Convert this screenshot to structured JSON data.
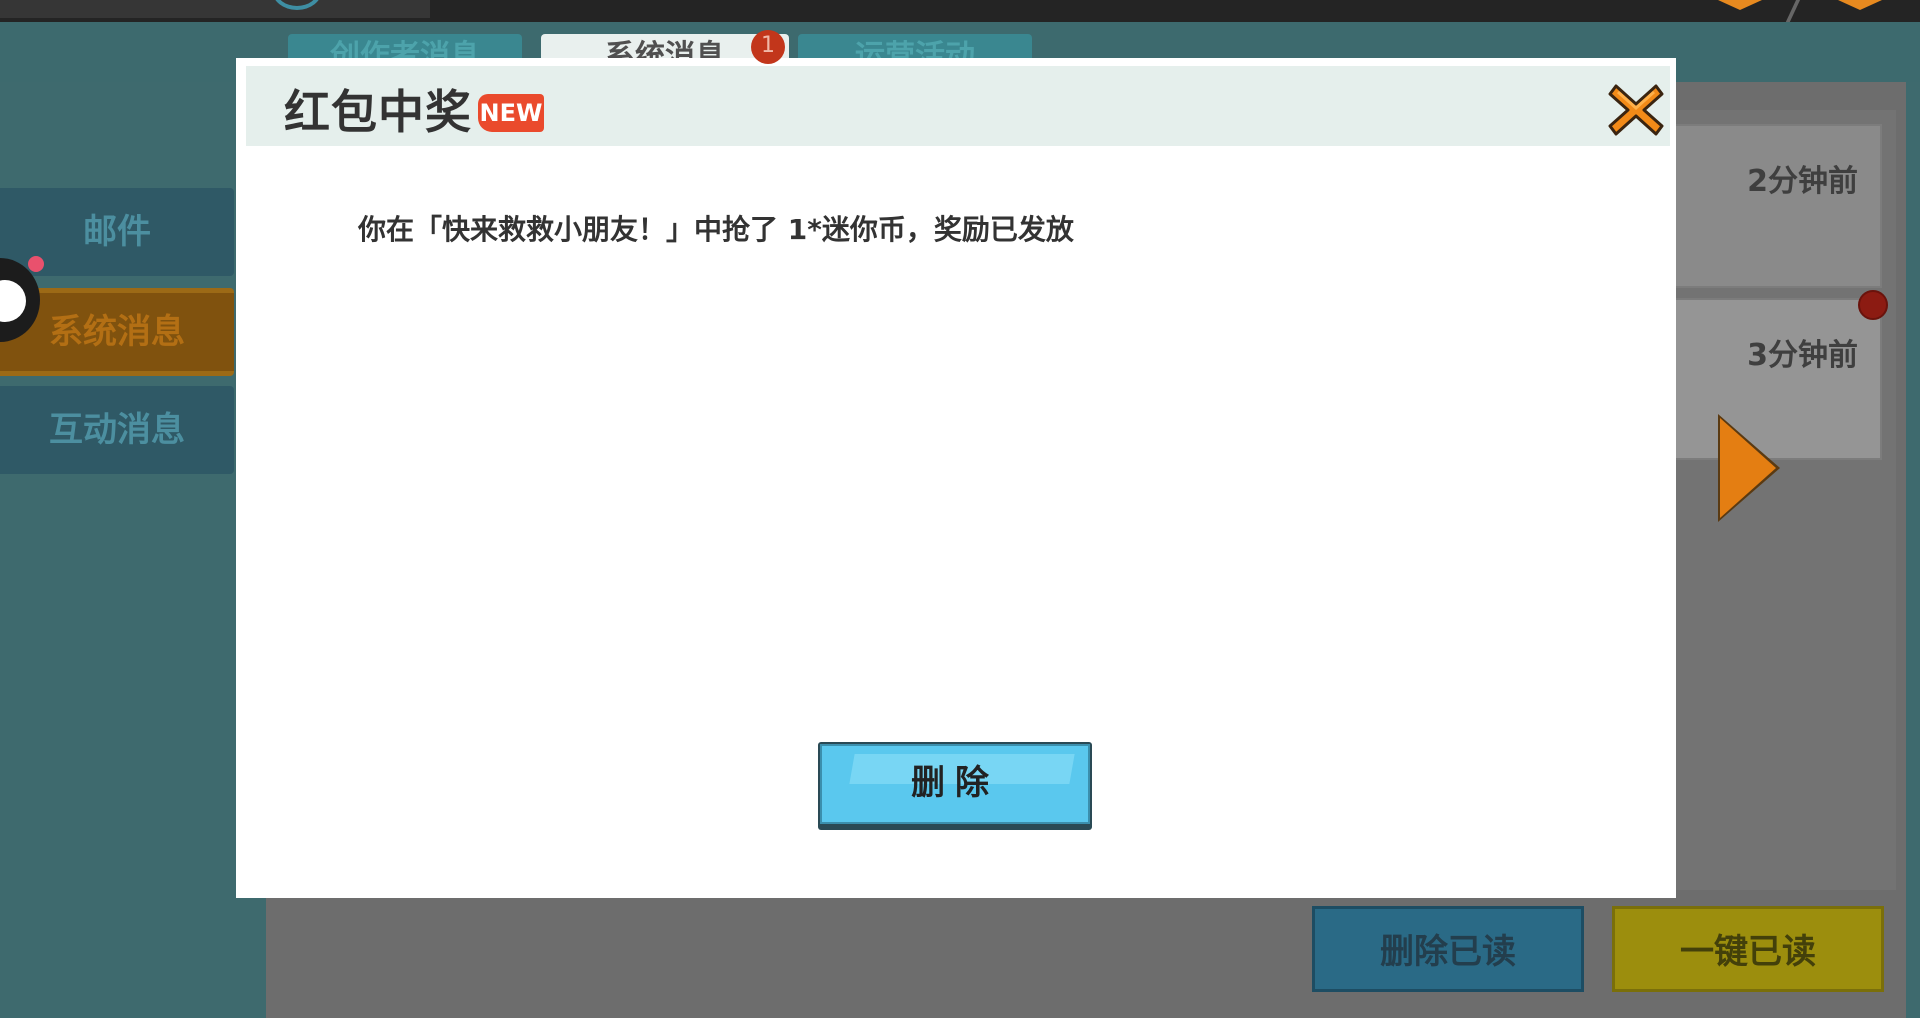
{
  "tabs": [
    {
      "label": "创作者消息"
    },
    {
      "label": "系统消息"
    },
    {
      "label": "运营活动"
    }
  ],
  "tab_badge": "1",
  "sidebar": {
    "items": [
      {
        "label": "邮件"
      },
      {
        "label": "系统消息"
      },
      {
        "label": "互动消息"
      }
    ]
  },
  "messages": [
    {
      "time": "2分钟前"
    },
    {
      "time": "3分钟前"
    }
  ],
  "bottom_buttons": {
    "delete_read": "删除已读",
    "mark_all_read": "一键已读"
  },
  "modal": {
    "title": "红包中奖",
    "badge": "NEW",
    "message": "你在「快来救救小朋友！」中抢了 1*迷你币，奖励已发放",
    "delete_label": "删除"
  },
  "icons": {
    "close": "close-x-icon",
    "next": "arrow-right-icon"
  },
  "colors": {
    "accent_orange": "#e47e12",
    "button_blue": "#5ac8ee",
    "new_badge": "#ea4a2c"
  }
}
